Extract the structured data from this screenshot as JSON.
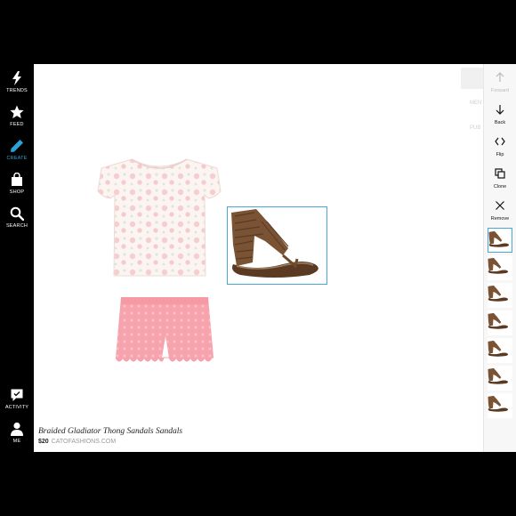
{
  "nav": {
    "items": [
      {
        "label": "TRENDS",
        "icon": "lightning-icon"
      },
      {
        "label": "FEED",
        "icon": "star-icon"
      },
      {
        "label": "CREATE",
        "icon": "pencil-icon",
        "active": true
      },
      {
        "label": "SHOP",
        "icon": "shopping-bag-icon"
      },
      {
        "label": "SEARCH",
        "icon": "search-icon"
      },
      {
        "label": "ACTIVITY",
        "icon": "speech-bubble-icon"
      },
      {
        "label": "ME",
        "icon": "person-icon"
      }
    ]
  },
  "tools": {
    "forward": "Forward",
    "back": "Back",
    "flip": "Flip",
    "clone": "Clone",
    "remove": "Remove"
  },
  "canvas": {
    "ghost_label_1": "MEN",
    "ghost_label_2": "PUB"
  },
  "item": {
    "title": "Braided Gladiator Thong Sandals Sandals",
    "price": "$20",
    "source": "CATOFASHIONS.COM"
  },
  "colors": {
    "accent": "#2aa4d8",
    "selection": "#4aa8d8",
    "shorts_pink": "#f7a3ad",
    "sandal_brown": "#6e4a2e"
  }
}
